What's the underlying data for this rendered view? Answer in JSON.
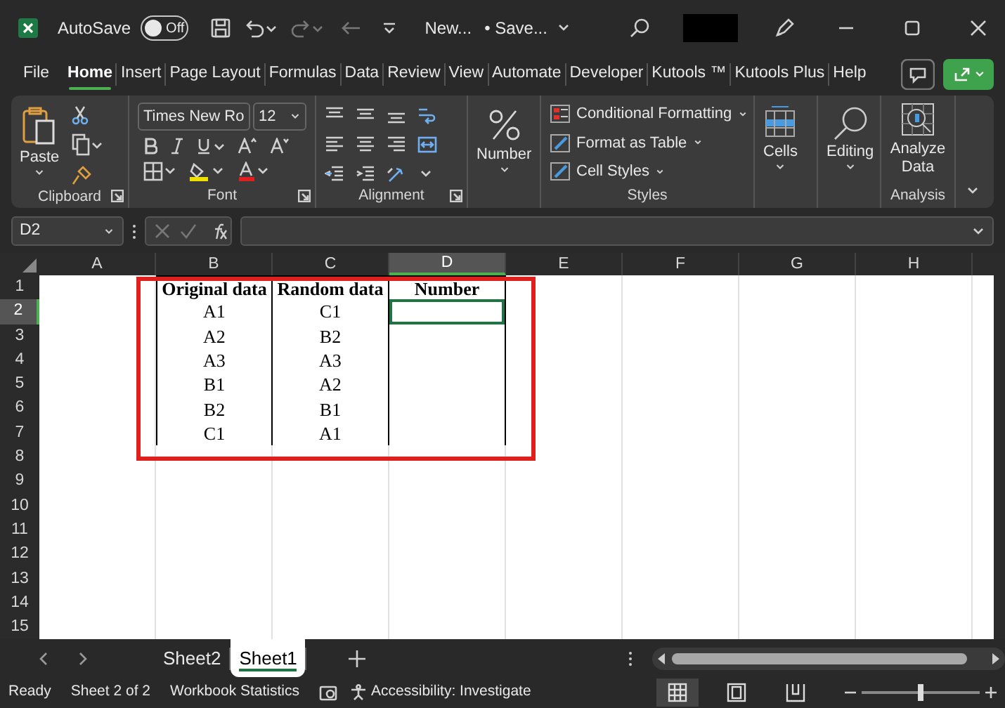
{
  "title_bar": {
    "autosave_label": "AutoSave",
    "autosave": {
      "on": false,
      "label": "Off"
    },
    "document": "New...",
    "save_status": "• Save..."
  },
  "ribbon_tabs": [
    {
      "label": "File",
      "selected": false
    },
    {
      "label": "Home",
      "selected": true
    },
    {
      "label": "Insert",
      "selected": false
    },
    {
      "label": "Page Layout",
      "selected": false
    },
    {
      "label": "Formulas",
      "selected": false
    },
    {
      "label": "Data",
      "selected": false
    },
    {
      "label": "Review",
      "selected": false
    },
    {
      "label": "View",
      "selected": false
    },
    {
      "label": "Automate",
      "selected": false
    },
    {
      "label": "Developer",
      "selected": false
    },
    {
      "label": "Kutools ™",
      "selected": false
    },
    {
      "label": "Kutools Plus",
      "selected": false
    },
    {
      "label": "Help",
      "selected": false
    }
  ],
  "ribbon": {
    "clipboard": {
      "paste": "Paste",
      "label": "Clipboard"
    },
    "font": {
      "name": "Times New Ro",
      "size": "12",
      "label": "Font"
    },
    "alignment": {
      "label": "Alignment"
    },
    "number": {
      "button": "Number"
    },
    "styles": {
      "items": [
        "Conditional Formatting",
        "Format as Table",
        "Cell Styles"
      ],
      "label": "Styles"
    },
    "cells": {
      "button": "Cells"
    },
    "editing": {
      "button": "Editing"
    },
    "analysis": {
      "button": "Analyze Data",
      "label": "Analysis"
    }
  },
  "name_box": "D2",
  "columns": [
    {
      "label": "A",
      "selected": false,
      "in_table": false
    },
    {
      "label": "B",
      "selected": false,
      "in_table": true
    },
    {
      "label": "C",
      "selected": false,
      "in_table": true
    },
    {
      "label": "D",
      "selected": true,
      "in_table": true
    },
    {
      "label": "E",
      "selected": false,
      "in_table": false
    },
    {
      "label": "F",
      "selected": false,
      "in_table": false
    },
    {
      "label": "G",
      "selected": false,
      "in_table": false
    },
    {
      "label": "H",
      "selected": false,
      "in_table": false
    }
  ],
  "rows": [
    {
      "label": "1",
      "selected": false,
      "kind": "table-header",
      "cells": [
        null,
        "Original data",
        "Random data",
        "Number"
      ]
    },
    {
      "label": "2",
      "selected": true,
      "kind": "table-row",
      "cells": [
        null,
        "A1",
        "C1"
      ]
    },
    {
      "label": "3",
      "selected": false,
      "kind": "table-row",
      "cells": [
        null,
        "A2",
        "B2"
      ]
    },
    {
      "label": "4",
      "selected": false,
      "kind": "table-row",
      "cells": [
        null,
        "A3",
        "A3"
      ]
    },
    {
      "label": "5",
      "selected": false,
      "kind": "table-row",
      "cells": [
        null,
        "B1",
        "A2"
      ]
    },
    {
      "label": "6",
      "selected": false,
      "kind": "table-row",
      "cells": [
        null,
        "B2",
        "B1"
      ]
    },
    {
      "label": "7",
      "selected": false,
      "kind": "table-row",
      "cells": [
        null,
        "C1",
        "A1"
      ]
    },
    {
      "label": "8",
      "selected": false,
      "kind": "blank"
    },
    {
      "label": "9",
      "selected": false,
      "kind": "blank"
    },
    {
      "label": "10",
      "selected": false,
      "kind": "blank"
    },
    {
      "label": "11",
      "selected": false,
      "kind": "blank"
    },
    {
      "label": "12",
      "selected": false,
      "kind": "blank"
    },
    {
      "label": "13",
      "selected": false,
      "kind": "blank"
    },
    {
      "label": "14",
      "selected": false,
      "kind": "blank"
    },
    {
      "label": "15",
      "selected": false,
      "kind": "blank"
    }
  ],
  "sheet_tabs": [
    {
      "label": "Sheet2",
      "selected": false
    },
    {
      "label": "Sheet1",
      "selected": true
    }
  ],
  "status_bar": {
    "items": [
      "Ready",
      "Sheet 2 of 2",
      "Workbook Statistics",
      "Accessibility: Investigate"
    ],
    "views": [
      {
        "kind": "normal",
        "selected": true
      },
      {
        "kind": "page-layout",
        "selected": false
      },
      {
        "kind": "page-break",
        "selected": false
      }
    ],
    "zoom": {
      "level": 0.5
    }
  }
}
